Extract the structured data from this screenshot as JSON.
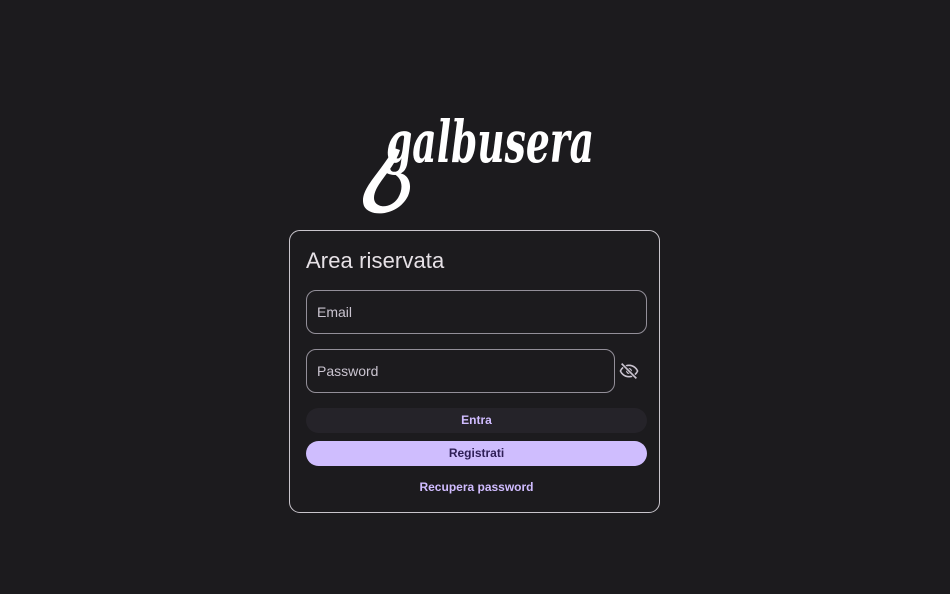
{
  "brand": {
    "logo_text": "galbusera"
  },
  "login": {
    "title": "Area riservata",
    "email_label": "Email",
    "password_label": "Password",
    "toggle_password_icon": "eye-off-icon",
    "enter_label": "Entra",
    "register_label": "Registrati",
    "recover_label": "Recupera password"
  },
  "colors": {
    "background": "#1c1b1e",
    "card_border": "#c9c5cc",
    "accent": "#d0bcff",
    "primary_button": "#cfbdfe",
    "primary_button_text": "#2f1f57"
  }
}
